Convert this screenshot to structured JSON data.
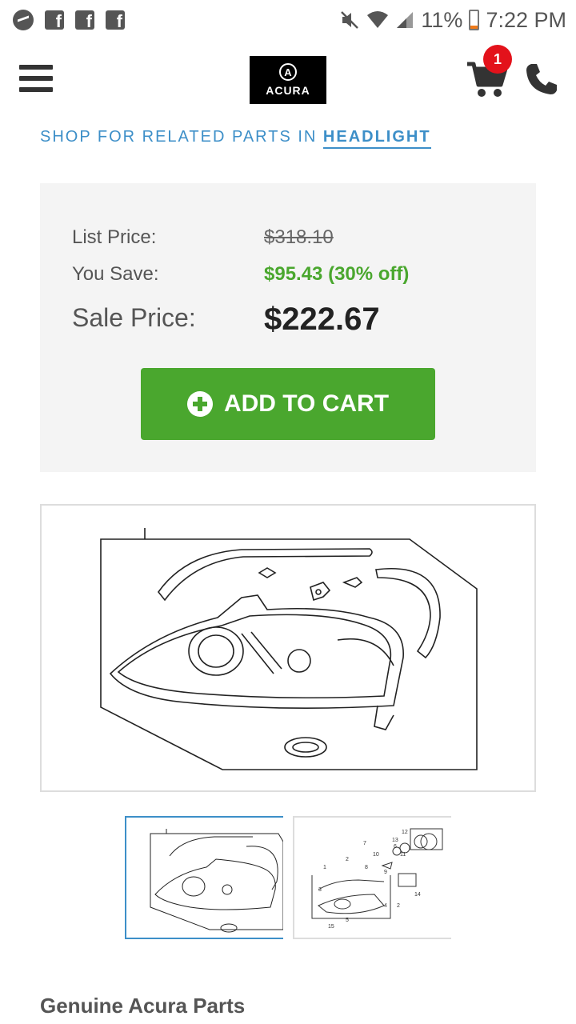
{
  "status_bar": {
    "battery": "11%",
    "time": "7:22 PM"
  },
  "header": {
    "logo_text": "ACURA",
    "logo_mark": "A",
    "cart_count": "1"
  },
  "related": {
    "prefix": "SHOP FOR RELATED PARTS IN ",
    "link": "HEADLIGHT"
  },
  "price": {
    "list_label": "List Price:",
    "list_value": "$318.10",
    "save_label": "You Save:",
    "save_value": "$95.43 (30% off)",
    "sale_label": "Sale Price:",
    "sale_value": "$222.67",
    "add_to_cart": "ADD TO CART"
  },
  "thumbnail_callouts": [
    "12",
    "7",
    "13",
    "6",
    "10",
    "11",
    "2",
    "8",
    "9",
    "1",
    "3",
    "4",
    "14",
    "2",
    "5",
    "15"
  ],
  "footer_heading": "Genuine Acura Parts",
  "colors": {
    "accent_blue": "#3d8fc8",
    "cta_green": "#4aa72e",
    "badge_red": "#e3121b"
  }
}
